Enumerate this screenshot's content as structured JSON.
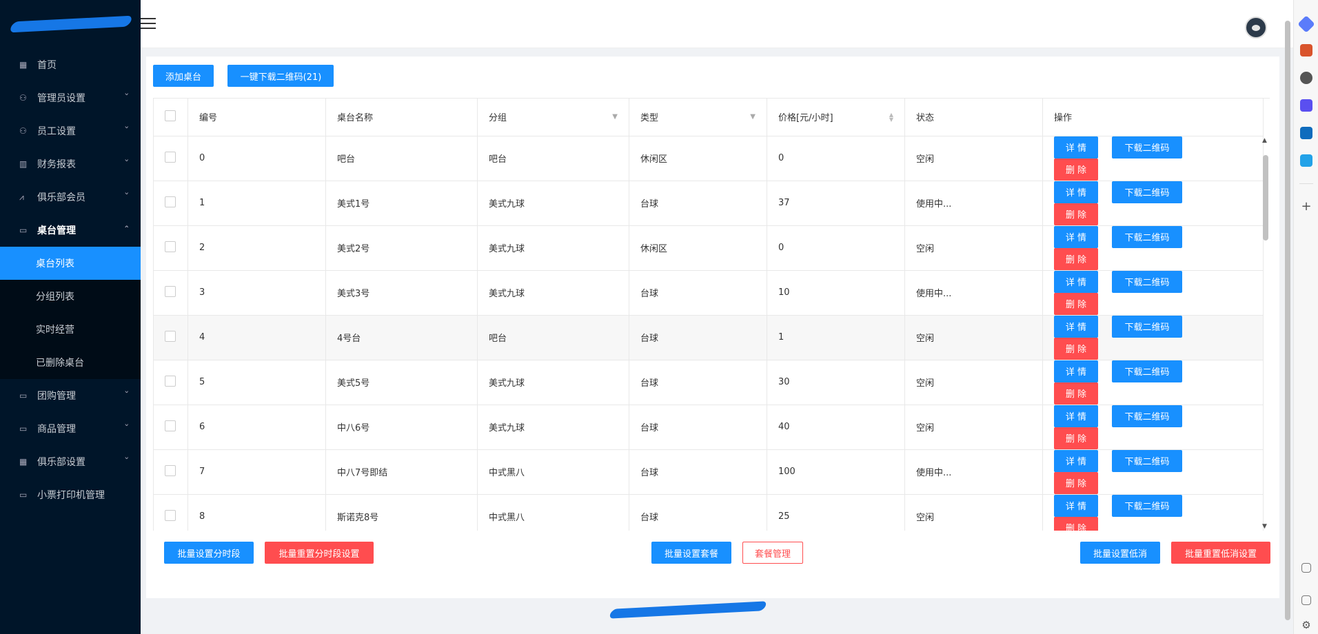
{
  "sidebar": {
    "items": [
      {
        "label": "首页",
        "icon": "dashboard-icon",
        "glyph": "▦",
        "has_children": false
      },
      {
        "label": "管理员设置",
        "icon": "admin-icon",
        "glyph": "⚇",
        "has_children": true
      },
      {
        "label": "员工设置",
        "icon": "staff-icon",
        "glyph": "⚇",
        "has_children": true
      },
      {
        "label": "财务报表",
        "icon": "bar-chart-icon",
        "glyph": "▥",
        "has_children": true
      },
      {
        "label": "俱乐部会员",
        "icon": "line-chart-icon",
        "glyph": "⩘",
        "has_children": true
      },
      {
        "label": "桌台管理",
        "icon": "laptop-icon",
        "glyph": "▭",
        "has_children": true,
        "open": true
      }
    ],
    "submenu": [
      {
        "label": "桌台列表",
        "active": true
      },
      {
        "label": "分组列表"
      },
      {
        "label": "实时经营"
      },
      {
        "label": "已删除桌台"
      }
    ],
    "items_after": [
      {
        "label": "团购管理",
        "icon": "laptop-icon",
        "glyph": "▭",
        "has_children": true
      },
      {
        "label": "商品管理",
        "icon": "laptop-icon",
        "glyph": "▭",
        "has_children": true
      },
      {
        "label": "俱乐部设置",
        "icon": "dashboard-icon",
        "glyph": "▦",
        "has_children": true
      },
      {
        "label": "小票打印机管理",
        "icon": "laptop-icon",
        "glyph": "▭",
        "has_children": false
      }
    ]
  },
  "toolbar": {
    "add_label": "添加桌台",
    "download_all_label": "一键下载二维码(21)"
  },
  "table": {
    "headers": {
      "id": "编号",
      "name": "桌台名称",
      "group": "分组",
      "type": "类型",
      "price": "价格[元/小时]",
      "status": "状态",
      "actions": "操作"
    },
    "rows": [
      {
        "id": "0",
        "name": "吧台",
        "group": "吧台",
        "type": "休闲区",
        "price": "0",
        "status": "空闲"
      },
      {
        "id": "1",
        "name": "美式1号",
        "group": "美式九球",
        "type": "台球",
        "price": "37",
        "status": "使用中..."
      },
      {
        "id": "2",
        "name": "美式2号",
        "group": "美式九球",
        "type": "休闲区",
        "price": "0",
        "status": "空闲"
      },
      {
        "id": "3",
        "name": "美式3号",
        "group": "美式九球",
        "type": "台球",
        "price": "10",
        "status": "使用中..."
      },
      {
        "id": "4",
        "name": "4号台",
        "group": "吧台",
        "type": "台球",
        "price": "1",
        "status": "空闲",
        "highlight": true
      },
      {
        "id": "5",
        "name": "美式5号",
        "group": "美式九球",
        "type": "台球",
        "price": "30",
        "status": "空闲"
      },
      {
        "id": "6",
        "name": "中八6号",
        "group": "美式九球",
        "type": "台球",
        "price": "40",
        "status": "空闲"
      },
      {
        "id": "7",
        "name": "中八7号即结",
        "group": "中式黑八",
        "type": "台球",
        "price": "100",
        "status": "使用中..."
      },
      {
        "id": "8",
        "name": "斯诺克8号",
        "group": "中式黑八",
        "type": "台球",
        "price": "25",
        "status": "空闲"
      }
    ],
    "row_actions": {
      "detail": "详 情",
      "download_qr": "下载二维码",
      "delete": "删 除"
    }
  },
  "bottom": {
    "batch_time_slot": "批量设置分时段",
    "batch_reset_time_slot": "批量重置分时段设置",
    "batch_package": "批量设置套餐",
    "package_manage": "套餐管理",
    "batch_min_consume": "批量设置低消",
    "batch_reset_min_consume": "批量重置低消设置"
  },
  "colors": {
    "sidebar_bg": "#001529",
    "primary": "#1890ff",
    "danger": "#ff4d4f"
  }
}
